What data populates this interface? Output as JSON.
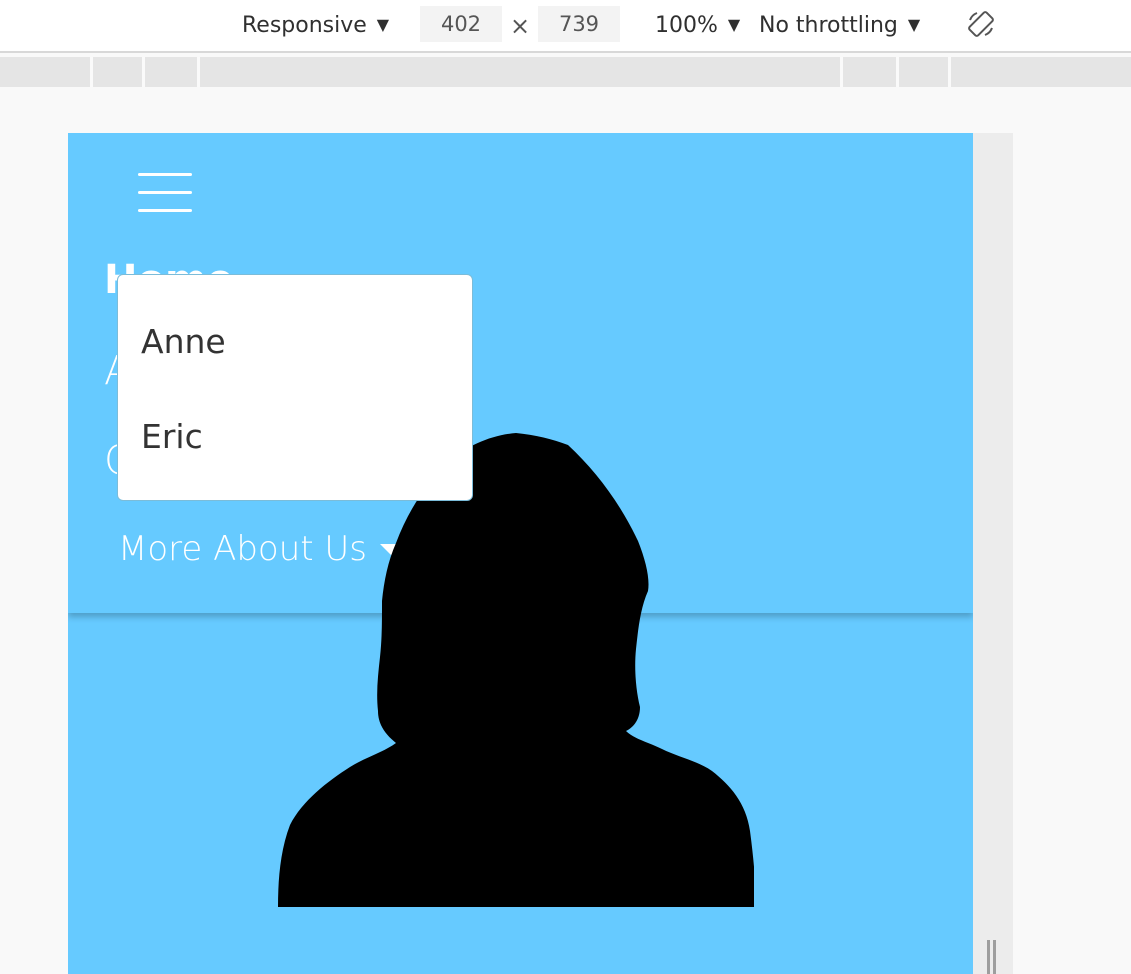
{
  "devtools": {
    "device_mode": "Responsive",
    "width": "402",
    "separator": "×",
    "height": "739",
    "zoom": "100%",
    "throttling": "No throttling",
    "caret": "▼"
  },
  "nav": {
    "links": [
      "Home",
      "A",
      "C"
    ],
    "more_label": "More About Us"
  },
  "dropdown": {
    "items": [
      "Anne",
      "Eric"
    ]
  },
  "colors": {
    "page_background": "#66caff",
    "nav_text": "#ffffff",
    "silhouette": "#000000"
  },
  "icons": {
    "menu": "hamburger-menu-icon",
    "rotate": "rotate-device-icon",
    "dropdown_caret": "caret-down-icon",
    "profile": "person-silhouette-icon"
  }
}
